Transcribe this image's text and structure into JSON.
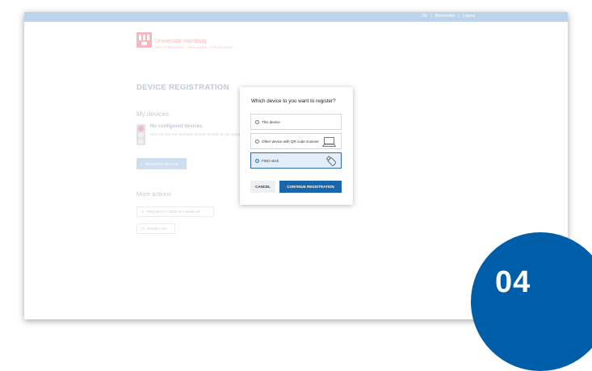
{
  "top_nav": {
    "lang": "DE",
    "help": "Barrierefrei",
    "logout": "Logout"
  },
  "brand": {
    "name": "Universität Hamburg",
    "tagline": "DER FORSCHUNG · DER LEHRE · DER BILDUNG"
  },
  "page": {
    "title": "DEVICE REGISTRATION",
    "my_devices": "My devices",
    "no_devices_title": "No configured devices",
    "no_devices_desc": "Here you see your two-factor devices as soon as you register one",
    "register_button": "REGISTER DEVICE",
    "more_actions": "More actions",
    "actions": [
      {
        "label": "REQUEST A NEW 2FA SIGN-UP",
        "icon": "refresh-icon"
      },
      {
        "label": "SHOW LOG",
        "icon": "clock-icon"
      }
    ]
  },
  "dialog": {
    "title": "Which device to you want to register?",
    "options": [
      {
        "label": "This device",
        "selected": false,
        "icon": ""
      },
      {
        "label": "Other device with QR code scanner",
        "selected": false,
        "icon": "laptop-icon"
      },
      {
        "label": "FIDO stick",
        "selected": true,
        "icon": "usb-stick-icon"
      }
    ],
    "cancel": "CANCEL",
    "continue": "CONTINUE REGISTRATION"
  },
  "step_badge": "04",
  "colors": {
    "primary": "#1b66a6",
    "badge": "#005ea8",
    "selected_bg": "#e2effa",
    "brand_red": "#e2001a",
    "topbar": "#bcd4ea"
  }
}
